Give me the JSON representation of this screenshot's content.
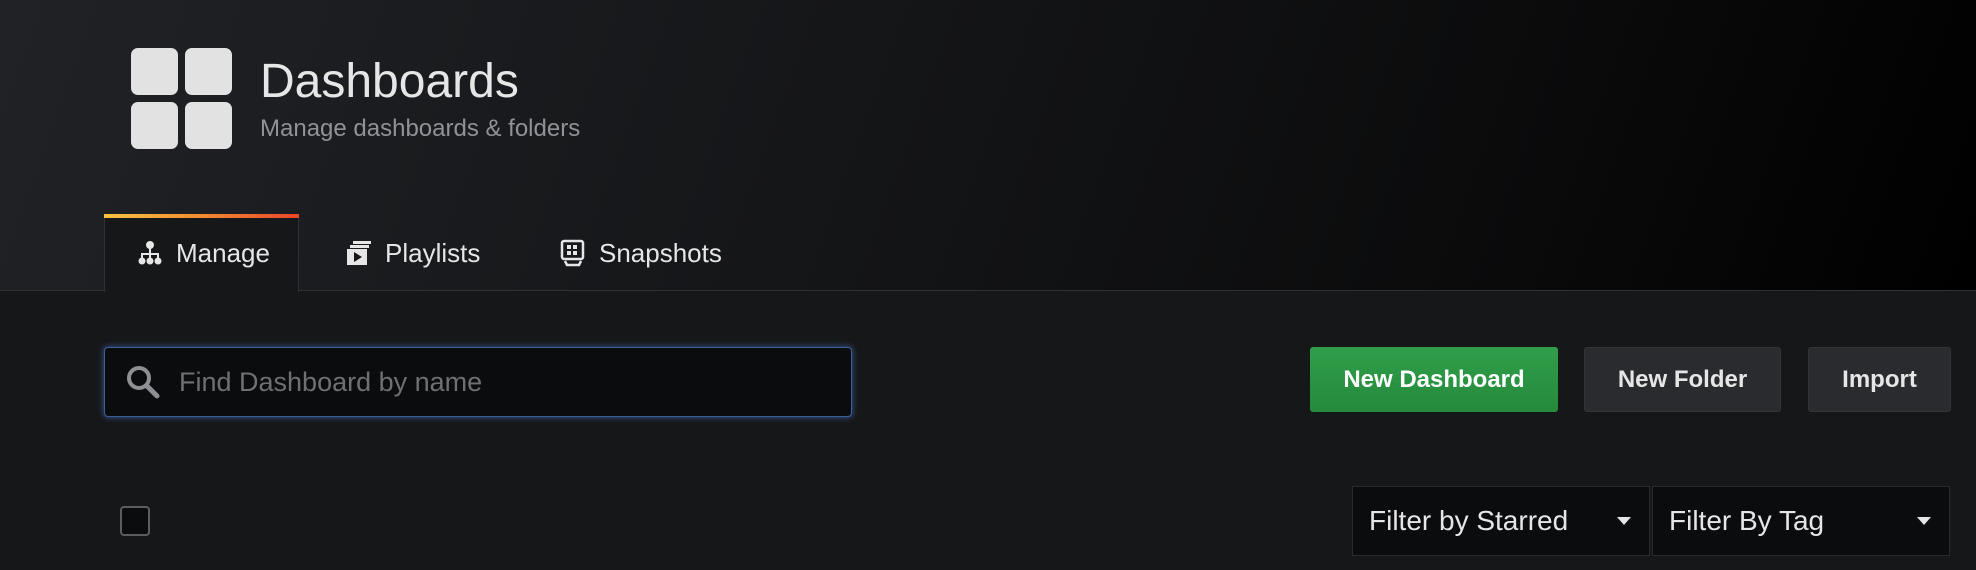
{
  "header": {
    "title": "Dashboards",
    "subtitle": "Manage dashboards & folders",
    "icon": "dashboard-grid-icon"
  },
  "tabs": [
    {
      "label": "Manage",
      "icon": "sitemap-icon",
      "active": true
    },
    {
      "label": "Playlists",
      "icon": "playlist-icon",
      "active": false
    },
    {
      "label": "Snapshots",
      "icon": "snapshot-icon",
      "active": false
    }
  ],
  "search": {
    "placeholder": "Find Dashboard by name",
    "value": ""
  },
  "actions": {
    "new_dashboard": "New Dashboard",
    "new_folder": "New Folder",
    "import": "Import"
  },
  "filters": {
    "starred": "Filter by Starred",
    "tag": "Filter By Tag"
  },
  "colors": {
    "background": "#161719",
    "primary_button": "#299c46",
    "accent_gradient_start": "#f6c244",
    "accent_gradient_end": "#e9452c",
    "search_focus": "#3b5f98"
  }
}
